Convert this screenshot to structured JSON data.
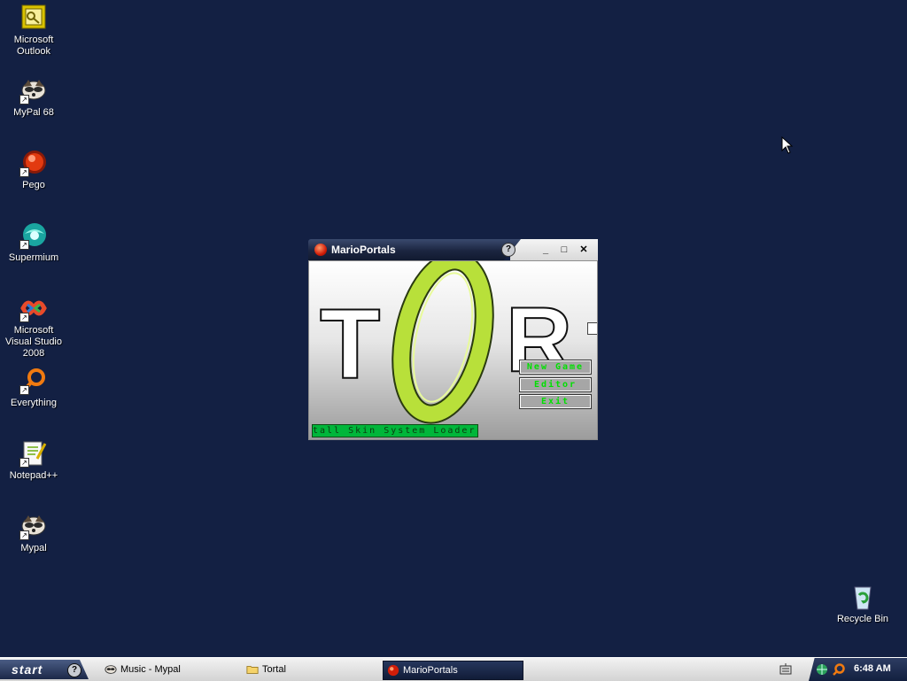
{
  "desktop": {
    "icons": [
      {
        "label": "Microsoft Outlook",
        "icon": "outlook-icon"
      },
      {
        "label": "MyPal 68",
        "icon": "raccoon-icon"
      },
      {
        "label": "Pego",
        "icon": "pego-icon"
      },
      {
        "label": "Supermium",
        "icon": "supermium-icon"
      },
      {
        "label": "Microsoft Visual Studio 2008",
        "icon": "visual-studio-icon"
      },
      {
        "label": "Everything",
        "icon": "everything-icon"
      },
      {
        "label": "Notepad++",
        "icon": "notepad-plus-plus-icon"
      },
      {
        "label": "Mypal",
        "icon": "raccoon-icon"
      },
      {
        "label": "Recycle Bin",
        "icon": "recycle-bin-icon"
      }
    ]
  },
  "window": {
    "title": "MarioPortals",
    "controls": {
      "help": "?",
      "minimize": "_",
      "maximize": "□",
      "close": "✕"
    },
    "logo_letters": {
      "left": "T",
      "right": "R"
    },
    "menu": {
      "new_game": "New Game",
      "editor": "Editor",
      "exit": "Exit"
    },
    "status_text": "tall Skin System Loader",
    "colors": {
      "portal": "#b8e03a",
      "menu_text": "#00e000",
      "status_bg": "#00b63a"
    }
  },
  "taskbar": {
    "start_label": "start",
    "tasks": [
      {
        "label": "Music - Mypal",
        "icon": "raccoon-icon",
        "active": false
      },
      {
        "label": "Tortal",
        "icon": "folder-icon",
        "active": false
      },
      {
        "label": "MarioPortals",
        "icon": "mario-portals-icon",
        "active": true
      }
    ],
    "clock": "6:48 AM"
  }
}
